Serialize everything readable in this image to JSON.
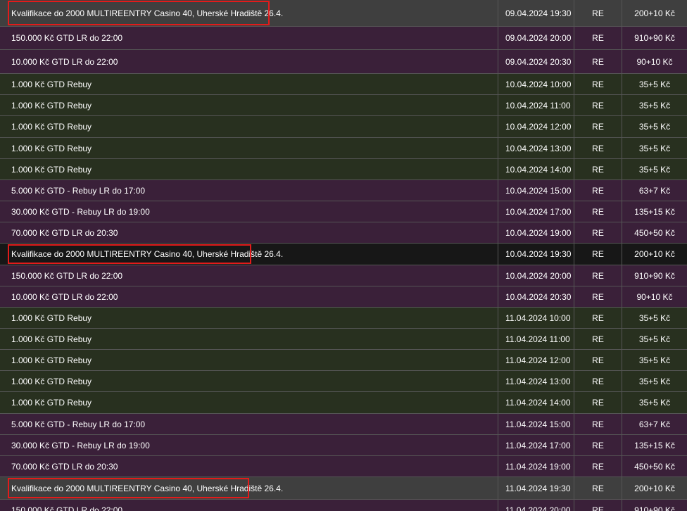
{
  "schedule": {
    "rows": [
      {
        "name": "Kvalifikace do 2000 MULTIREENTRY Casino 40, Uherské Hradiště 26.4.",
        "datetime": "09.04.2024 19:30",
        "type": "RE",
        "price": "200+10 Kč",
        "variant": "gray",
        "highlighted": true
      },
      {
        "name": "150.000 Kč GTD LR do 22:00",
        "datetime": "09.04.2024 20:00",
        "type": "RE",
        "price": "910+90 Kč",
        "variant": "purple",
        "highlighted": false
      },
      {
        "name": "10.000 Kč GTD LR do 22:00",
        "datetime": "09.04.2024 20:30",
        "type": "RE",
        "price": "90+10 Kč",
        "variant": "purple",
        "highlighted": false
      },
      {
        "name": "1.000 Kč GTD Rebuy",
        "datetime": "10.04.2024 10:00",
        "type": "RE",
        "price": "35+5 Kč",
        "variant": "green",
        "highlighted": false
      },
      {
        "name": "1.000 Kč GTD Rebuy",
        "datetime": "10.04.2024 11:00",
        "type": "RE",
        "price": "35+5 Kč",
        "variant": "green",
        "highlighted": false
      },
      {
        "name": "1.000 Kč GTD Rebuy",
        "datetime": "10.04.2024 12:00",
        "type": "RE",
        "price": "35+5 Kč",
        "variant": "green",
        "highlighted": false
      },
      {
        "name": "1.000 Kč GTD Rebuy",
        "datetime": "10.04.2024 13:00",
        "type": "RE",
        "price": "35+5 Kč",
        "variant": "green",
        "highlighted": false
      },
      {
        "name": "1.000 Kč GTD Rebuy",
        "datetime": "10.04.2024 14:00",
        "type": "RE",
        "price": "35+5 Kč",
        "variant": "green",
        "highlighted": false
      },
      {
        "name": "5.000 Kč GTD - Rebuy LR do 17:00",
        "datetime": "10.04.2024 15:00",
        "type": "RE",
        "price": "63+7 Kč",
        "variant": "purple",
        "highlighted": false
      },
      {
        "name": "30.000 Kč GTD - Rebuy LR do 19:00",
        "datetime": "10.04.2024 17:00",
        "type": "RE",
        "price": "135+15 Kč",
        "variant": "purple",
        "highlighted": false
      },
      {
        "name": "70.000 Kč GTD LR do 20:30",
        "datetime": "10.04.2024 19:00",
        "type": "RE",
        "price": "450+50 Kč",
        "variant": "purple",
        "highlighted": false
      },
      {
        "name": "Kvalifikace do 2000 MULTIREENTRY Casino 40, Uherské Hradiště 26.4.",
        "datetime": "10.04.2024 19:30",
        "type": "RE",
        "price": "200+10 Kč",
        "variant": "black",
        "highlighted": true
      },
      {
        "name": "150.000 Kč GTD LR do 22:00",
        "datetime": "10.04.2024 20:00",
        "type": "RE",
        "price": "910+90 Kč",
        "variant": "purple",
        "highlighted": false
      },
      {
        "name": "10.000 Kč GTD LR do 22:00",
        "datetime": "10.04.2024 20:30",
        "type": "RE",
        "price": "90+10 Kč",
        "variant": "purple",
        "highlighted": false
      },
      {
        "name": "1.000 Kč GTD Rebuy",
        "datetime": "11.04.2024 10:00",
        "type": "RE",
        "price": "35+5 Kč",
        "variant": "green",
        "highlighted": false
      },
      {
        "name": "1.000 Kč GTD Rebuy",
        "datetime": "11.04.2024 11:00",
        "type": "RE",
        "price": "35+5 Kč",
        "variant": "green",
        "highlighted": false
      },
      {
        "name": "1.000 Kč GTD Rebuy",
        "datetime": "11.04.2024 12:00",
        "type": "RE",
        "price": "35+5 Kč",
        "variant": "green",
        "highlighted": false
      },
      {
        "name": "1.000 Kč GTD Rebuy",
        "datetime": "11.04.2024 13:00",
        "type": "RE",
        "price": "35+5 Kč",
        "variant": "green",
        "highlighted": false
      },
      {
        "name": "1.000 Kč GTD Rebuy",
        "datetime": "11.04.2024 14:00",
        "type": "RE",
        "price": "35+5 Kč",
        "variant": "green",
        "highlighted": false
      },
      {
        "name": "5.000 Kč GTD - Rebuy LR do 17:00",
        "datetime": "11.04.2024 15:00",
        "type": "RE",
        "price": "63+7 Kč",
        "variant": "purple",
        "highlighted": false
      },
      {
        "name": "30.000 Kč GTD - Rebuy LR do 19:00",
        "datetime": "11.04.2024 17:00",
        "type": "RE",
        "price": "135+15 Kč",
        "variant": "purple",
        "highlighted": false
      },
      {
        "name": "70.000 Kč GTD LR do 20:30",
        "datetime": "11.04.2024 19:00",
        "type": "RE",
        "price": "450+50 Kč",
        "variant": "purple",
        "highlighted": false
      },
      {
        "name": "Kvalifikace do 2000 MULTIREENTRY Casino 40, Uherské Hradiště 26.4.",
        "datetime": "11.04.2024 19:30",
        "type": "RE",
        "price": "200+10 Kč",
        "variant": "gray",
        "highlighted": true
      },
      {
        "name": "150.000 Kč GTD LR do 22:00",
        "datetime": "11.04.2024 20:00",
        "type": "RE",
        "price": "910+90 Kč",
        "variant": "purple",
        "highlighted": false
      }
    ]
  }
}
